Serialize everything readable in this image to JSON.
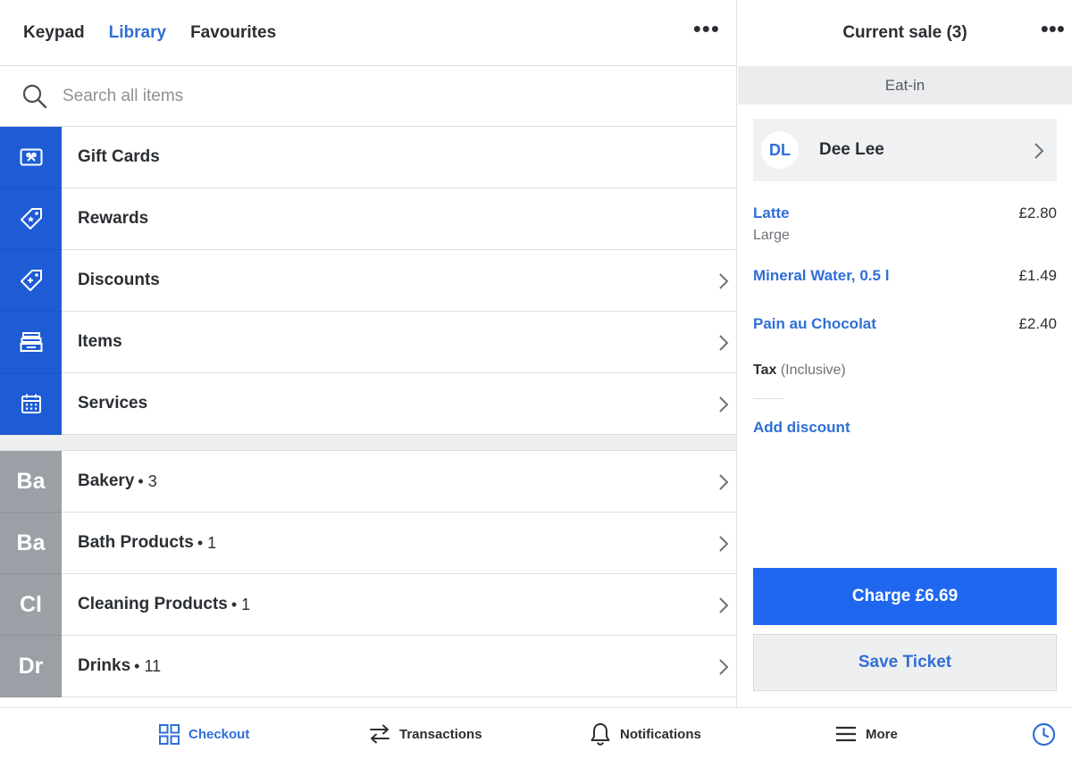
{
  "header": {
    "tabs": [
      {
        "label": "Keypad",
        "active": false
      },
      {
        "label": "Library",
        "active": true
      },
      {
        "label": "Favourites",
        "active": false
      }
    ],
    "more_glyph": "•••"
  },
  "search": {
    "placeholder": "Search all items",
    "value": ""
  },
  "library": {
    "special_items": [
      {
        "label": "Gift Cards",
        "icon": "gift-card-icon",
        "chevron": false
      },
      {
        "label": "Rewards",
        "icon": "reward-tag-icon",
        "chevron": false
      },
      {
        "label": "Discounts",
        "icon": "discount-tag-icon",
        "chevron": true
      },
      {
        "label": "Items",
        "icon": "items-tray-icon",
        "chevron": true
      },
      {
        "label": "Services",
        "icon": "calendar-icon",
        "chevron": true
      }
    ],
    "categories": [
      {
        "abbr": "Ba",
        "label": "Bakery",
        "count": "• 3"
      },
      {
        "abbr": "Ba",
        "label": "Bath Products",
        "count": "• 1"
      },
      {
        "abbr": "Cl",
        "label": "Cleaning Products",
        "count": "• 1"
      },
      {
        "abbr": "Dr",
        "label": "Drinks",
        "count": "• 11"
      }
    ]
  },
  "sale": {
    "title": "Current sale (3)",
    "more_glyph": "•••",
    "dining_option": "Eat-in",
    "customer": {
      "initials": "DL",
      "name": "Dee Lee"
    },
    "lines": [
      {
        "name": "Latte",
        "price": "£2.80",
        "modifier": "Large"
      },
      {
        "name": "Mineral Water, 0.5 l",
        "price": "£1.49",
        "modifier": ""
      },
      {
        "name": "Pain au Chocolat",
        "price": "£2.40",
        "modifier": ""
      }
    ],
    "tax_label": "Tax",
    "tax_note": "(Inclusive)",
    "add_discount_label": "Add discount",
    "charge_label": "Charge £6.69",
    "save_ticket_label": "Save Ticket"
  },
  "bottom_nav": {
    "items": [
      {
        "label": "Checkout",
        "icon": "grid-icon",
        "active": true
      },
      {
        "label": "Transactions",
        "icon": "arrows-swap-icon",
        "active": false
      },
      {
        "label": "Notifications",
        "icon": "bell-icon",
        "active": false
      },
      {
        "label": "More",
        "icon": "hamburger-icon",
        "active": false
      }
    ],
    "clock_icon": "clock-icon"
  },
  "colors": {
    "accent": "#2f6fd6",
    "primary_button": "#2067f0",
    "tile_blue": "#1e5cd6",
    "tile_grey": "#9aa0a6"
  }
}
